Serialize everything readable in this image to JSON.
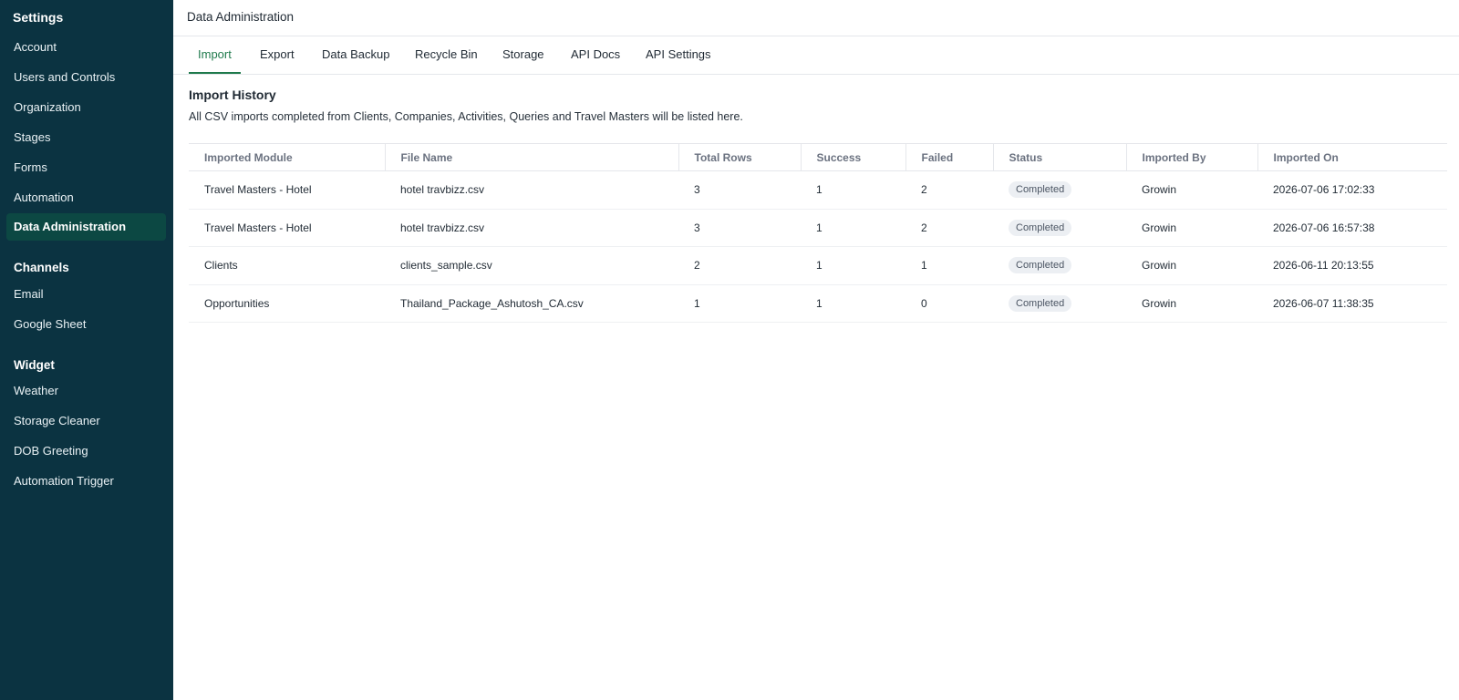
{
  "sidebar": {
    "title": "Settings",
    "items": [
      {
        "label": "Account"
      },
      {
        "label": "Users and Controls"
      },
      {
        "label": "Organization"
      },
      {
        "label": "Stages"
      },
      {
        "label": "Forms"
      },
      {
        "label": "Automation"
      },
      {
        "label": "Data Administration",
        "active": true
      }
    ],
    "channels": {
      "header": "Channels",
      "items": [
        {
          "label": "Email"
        },
        {
          "label": "Google Sheet"
        }
      ]
    },
    "widget": {
      "header": "Widget",
      "items": [
        {
          "label": "Weather"
        },
        {
          "label": "Storage Cleaner"
        },
        {
          "label": "DOB Greeting"
        },
        {
          "label": "Automation Trigger"
        }
      ]
    }
  },
  "header": {
    "title": "Data Administration"
  },
  "tabs": [
    {
      "label": "Import",
      "active": true
    },
    {
      "label": "Export"
    },
    {
      "label": "Data Backup"
    },
    {
      "label": "Recycle Bin"
    },
    {
      "label": "Storage"
    },
    {
      "label": "API Docs"
    },
    {
      "label": "API Settings"
    }
  ],
  "main": {
    "title": "Import History",
    "description": "All CSV imports completed from Clients, Companies, Activities, Queries and Travel Masters will be listed here.",
    "columns": [
      "Imported Module",
      "File Name",
      "Total Rows",
      "Success",
      "Failed",
      "Status",
      "Imported By",
      "Imported On"
    ],
    "rows": [
      [
        "Travel Masters - Hotel",
        "hotel travbizz.csv",
        "3",
        "1",
        "2",
        "Completed",
        "Growin",
        "2026-07-06 17:02:33"
      ],
      [
        "Travel Masters - Hotel",
        "hotel travbizz.csv",
        "3",
        "1",
        "2",
        "Completed",
        "Growin",
        "2026-07-06 16:57:38"
      ],
      [
        "Clients",
        "clients_sample.csv",
        "2",
        "1",
        "1",
        "Completed",
        "Growin",
        "2026-06-11 20:13:55"
      ],
      [
        "Opportunities",
        "Thailand_Package_Ashutosh_CA.csv",
        "1",
        "1",
        "0",
        "Completed",
        "Growin",
        "2026-06-07 11:38:35"
      ]
    ]
  },
  "colors": {
    "sidebar_bg": "#0b3341",
    "sidebar_active_bg": "#0c4843",
    "tab_active": "#1f7a4c",
    "badge_bg": "#eceff3"
  }
}
